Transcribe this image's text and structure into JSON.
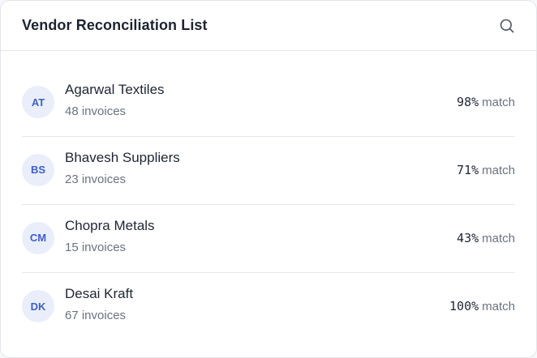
{
  "header": {
    "title": "Vendor Reconciliation List",
    "search_icon": "search-icon"
  },
  "vendors": [
    {
      "initials": "AT",
      "name": "Agarwal Textiles",
      "invoices": "48 invoices",
      "match_pct": "98%",
      "match_word": "match"
    },
    {
      "initials": "BS",
      "name": "Bhavesh Suppliers",
      "invoices": "23 invoices",
      "match_pct": "71%",
      "match_word": "match"
    },
    {
      "initials": "CM",
      "name": "Chopra Metals",
      "invoices": "15 invoices",
      "match_pct": "43%",
      "match_word": "match"
    },
    {
      "initials": "DK",
      "name": "Desai Kraft",
      "invoices": "67 invoices",
      "match_pct": "100%",
      "match_word": "match"
    }
  ],
  "colors": {
    "avatar_bg": "#eaeefb",
    "avatar_text": "#3d5fc7",
    "muted_text": "#6b7280",
    "divider": "#e6e8ee"
  }
}
